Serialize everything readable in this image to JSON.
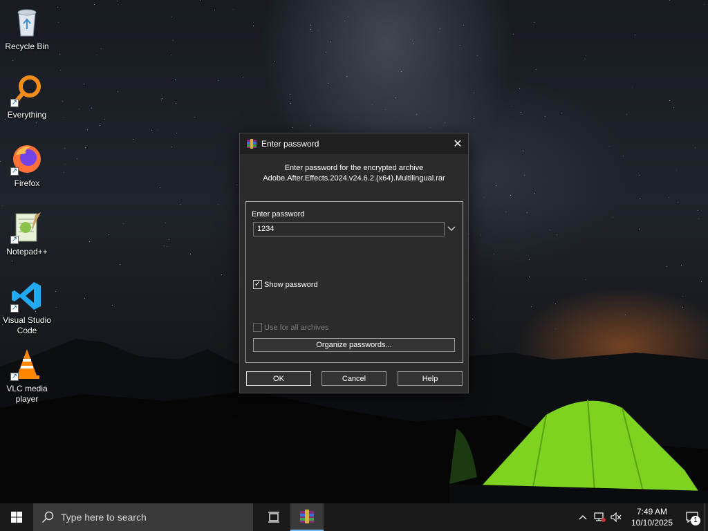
{
  "desktop": {
    "icons": [
      {
        "label": "Recycle Bin",
        "icon": "recycle-bin-icon"
      },
      {
        "label": "Everything",
        "icon": "everything-search-icon"
      },
      {
        "label": "Firefox",
        "icon": "firefox-icon"
      },
      {
        "label": "Notepad++",
        "icon": "notepad-plus-plus-icon"
      },
      {
        "label": "Visual Studio\nCode",
        "icon": "vscode-icon"
      },
      {
        "label": "VLC media\nplayer",
        "icon": "vlc-icon"
      }
    ]
  },
  "dialog": {
    "title": "Enter password",
    "prompt_line1": "Enter password for the encrypted archive",
    "prompt_line2": "Adobe.After.Effects.2024.v24.6.2.(x64).Multilingual.rar",
    "password_label": "Enter password",
    "password_value": "1234",
    "show_password_label": "Show password",
    "show_password_checked": true,
    "use_for_all_label": "Use for all archives",
    "use_for_all_checked": false,
    "organize_label": "Organize passwords...",
    "ok_label": "OK",
    "cancel_label": "Cancel",
    "help_label": "Help"
  },
  "taskbar": {
    "search_placeholder": "Type here to search",
    "time": "7:49 AM",
    "date": "10/10/2025",
    "notification_count": "1"
  },
  "colors": {
    "dialog_bg": "#2b2b2b",
    "titlebar_bg": "#202020",
    "taskbar_bg": "#1a1a1a",
    "tent_green": "#7ed321",
    "accent_blue": "#76b9ed"
  }
}
